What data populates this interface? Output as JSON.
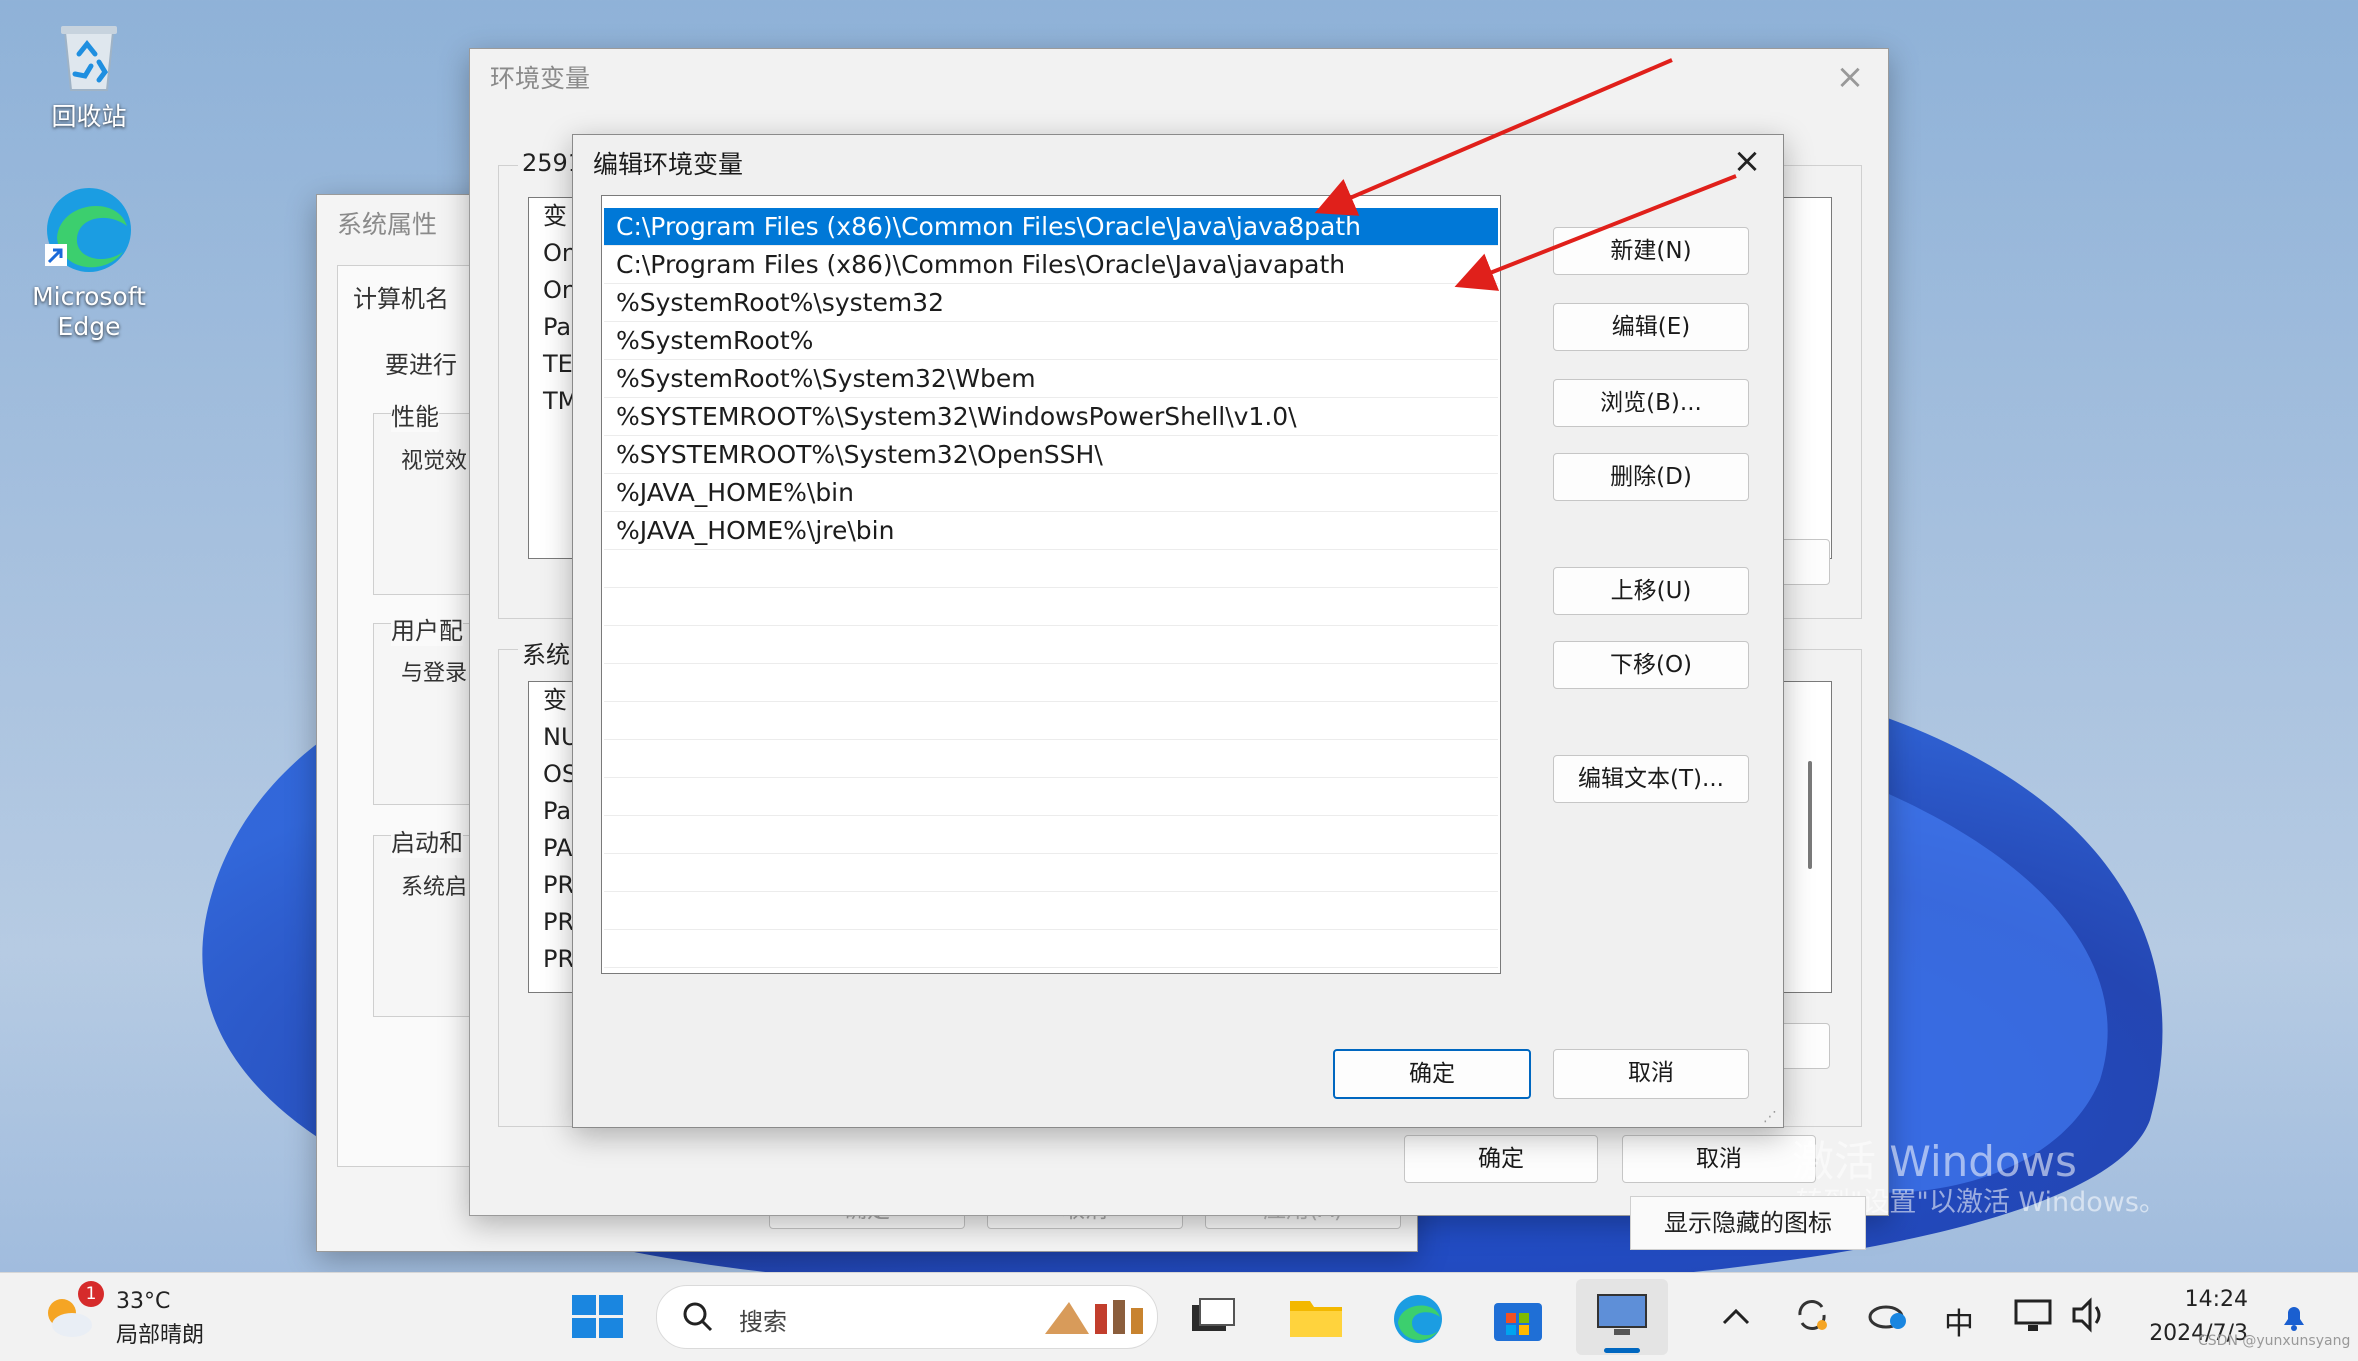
{
  "desktop": {
    "recycle_bin_label": "回收站",
    "edge_label_line1": "Microsoft",
    "edge_label_line2": "Edge"
  },
  "system_properties": {
    "title": "系统属性",
    "tab_computer_name": "计算机名",
    "text_requirement": "要进行",
    "section_performance": "性能",
    "text_visual": "视觉效",
    "section_user_profile": "用户配",
    "text_login": "与登录",
    "section_startup": "启动和",
    "text_system": "系统启",
    "btn_ok": "确定",
    "btn_cancel": "取消",
    "btn_apply": "应用(A)"
  },
  "env_vars": {
    "title": "环境变量",
    "user_vars_label": "2591",
    "user_list_header": "变",
    "user_list": [
      "On",
      "On",
      "Pa",
      "TE",
      "TM"
    ],
    "system_vars_label": "系统",
    "system_list_header": "变",
    "system_list": [
      "NU",
      "OS",
      "Pa",
      "PA",
      "PR",
      "PR",
      "PR"
    ],
    "btn_ok": "确定",
    "btn_cancel": "取消"
  },
  "edit_dialog": {
    "title": "编辑环境变量",
    "paths": [
      "C:\\Program Files (x86)\\Common Files\\Oracle\\Java\\java8path",
      "C:\\Program Files (x86)\\Common Files\\Oracle\\Java\\javapath",
      "%SystemRoot%\\system32",
      "%SystemRoot%",
      "%SystemRoot%\\System32\\Wbem",
      "%SYSTEMROOT%\\System32\\WindowsPowerShell\\v1.0\\",
      "%SYSTEMROOT%\\System32\\OpenSSH\\",
      "%JAVA_HOME%\\bin",
      "%JAVA_HOME%\\jre\\bin"
    ],
    "selected_index": 0,
    "btn_new": "新建(N)",
    "btn_edit": "编辑(E)",
    "btn_browse": "浏览(B)...",
    "btn_delete": "删除(D)",
    "btn_move_up": "上移(U)",
    "btn_move_down": "下移(O)",
    "btn_edit_text": "编辑文本(T)...",
    "btn_ok": "确定",
    "btn_cancel": "取消"
  },
  "watermark": {
    "line1": "激活 Windows",
    "line2": "转到\"设置\"以激活 Windows。"
  },
  "tray_tooltip": "显示隐藏的图标",
  "taskbar": {
    "weather_temp": "33°C",
    "weather_desc": "局部晴朗",
    "weather_badge": "1",
    "search_placeholder": "搜索",
    "ime": "中",
    "time": "14:24",
    "date": "2024/7/3",
    "credit": "CSDN @yunxunsyang"
  },
  "colors": {
    "selection_blue": "#0078d7",
    "arrow_red": "#e0201b",
    "windows_blue": "#0067c0"
  }
}
